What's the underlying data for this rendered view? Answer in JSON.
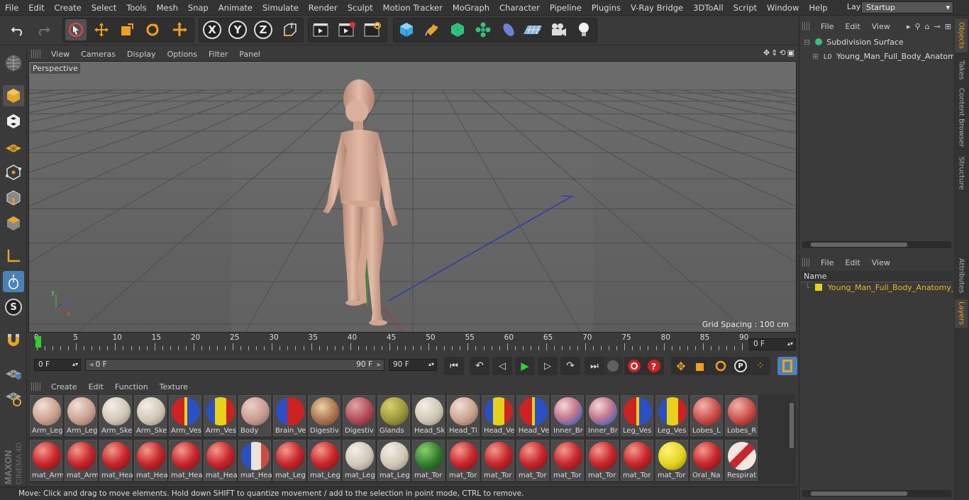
{
  "menubar": {
    "items": [
      "File",
      "Edit",
      "Create",
      "Select",
      "Tools",
      "Mesh",
      "Snap",
      "Animate",
      "Simulate",
      "Render",
      "Sculpt",
      "Motion Tracker",
      "MoGraph",
      "Character",
      "Pipeline",
      "Plugins",
      "V-Ray Bridge",
      "3DToAll",
      "Script",
      "Window",
      "Help"
    ],
    "layout_label": "Layout:",
    "layout_value": "Startup"
  },
  "toolbar": {
    "axis_x": "X",
    "axis_y": "Y",
    "axis_z": "Z"
  },
  "viewport": {
    "menu": [
      "View",
      "Cameras",
      "Display",
      "Options",
      "Filter",
      "Panel"
    ],
    "camera_label": "Perspective",
    "grid_spacing": "Grid Spacing : 100 cm",
    "axis_x": "x",
    "axis_y": "y",
    "axis_z": "z"
  },
  "timeline": {
    "ticks": [
      "0",
      "5",
      "10",
      "15",
      "20",
      "25",
      "30",
      "35",
      "40",
      "45",
      "50",
      "55",
      "60",
      "65",
      "70",
      "75",
      "80",
      "85",
      "90"
    ],
    "current_frame": "0 F"
  },
  "time_controls": {
    "start_field": "0 F",
    "range_start": "0 F",
    "range_end": "90 F",
    "end_field": "90 F"
  },
  "material_manager": {
    "menu": [
      "Create",
      "Edit",
      "Function",
      "Texture"
    ],
    "materials_row1": [
      {
        "name": "Arm_Leg",
        "kind": "skin"
      },
      {
        "name": "Arm_Leg",
        "kind": "skin"
      },
      {
        "name": "Arm_Ske",
        "kind": "bone"
      },
      {
        "name": "Arm_Ske",
        "kind": "bone"
      },
      {
        "name": "Arm_Ves",
        "kind": "vessel"
      },
      {
        "name": "Arm_Ves",
        "kind": "vessel2"
      },
      {
        "name": "Body",
        "kind": "body"
      },
      {
        "name": "Brain_Ve",
        "kind": "brainves"
      },
      {
        "name": "Digestiv",
        "kind": "digest"
      },
      {
        "name": "Digestiv",
        "kind": "digest2"
      },
      {
        "name": "Glands",
        "kind": "glands"
      },
      {
        "name": "Head_Sk",
        "kind": "bone"
      },
      {
        "name": "Head_Ti",
        "kind": "skin"
      },
      {
        "name": "Head_Ve",
        "kind": "vessel2"
      },
      {
        "name": "Head_Ve",
        "kind": "vessel"
      },
      {
        "name": "Inner_Br",
        "kind": "brain"
      },
      {
        "name": "Inner_Br",
        "kind": "brain"
      },
      {
        "name": "Leg_Ves",
        "kind": "vessel"
      },
      {
        "name": "Leg_Ves",
        "kind": "vessel2"
      },
      {
        "name": "Lobes_L",
        "kind": "lobes"
      },
      {
        "name": "Lobes_R",
        "kind": "lobes"
      }
    ],
    "materials_row2": [
      {
        "name": "mat_Arm",
        "kind": "muscle"
      },
      {
        "name": "mat_Arm",
        "kind": "muscle"
      },
      {
        "name": "mat_Hea",
        "kind": "muscle"
      },
      {
        "name": "mat_Hea",
        "kind": "muscle"
      },
      {
        "name": "mat_Hea",
        "kind": "muscle"
      },
      {
        "name": "mat_Hea",
        "kind": "muscle"
      },
      {
        "name": "mat_Hea",
        "kind": "eye"
      },
      {
        "name": "mat_Leg",
        "kind": "muscle"
      },
      {
        "name": "mat_Leg",
        "kind": "muscle"
      },
      {
        "name": "mat_Leg",
        "kind": "bone"
      },
      {
        "name": "mat_Leg",
        "kind": "bone"
      },
      {
        "name": "mat_Tor",
        "kind": "green"
      },
      {
        "name": "mat_Tor",
        "kind": "muscle"
      },
      {
        "name": "mat_Tor",
        "kind": "muscle"
      },
      {
        "name": "mat_Tor",
        "kind": "muscle"
      },
      {
        "name": "mat_Tor",
        "kind": "muscle"
      },
      {
        "name": "mat_Tor",
        "kind": "muscle"
      },
      {
        "name": "mat_Tor",
        "kind": "muscle"
      },
      {
        "name": "mat_Tor",
        "kind": "yellow"
      },
      {
        "name": "Oral_Na",
        "kind": "muscle"
      },
      {
        "name": "Respirat",
        "kind": "resp"
      }
    ]
  },
  "status_bar": {
    "text": "Move: Click and drag to move elements. Hold down SHIFT to quantize movement / add to the selection in point mode, CTRL to remove."
  },
  "object_manager": {
    "menu": [
      "File",
      "Edit",
      "View"
    ],
    "objects": [
      {
        "name": "Subdivision Surface"
      },
      {
        "name": "Young_Man_Full_Body_Anatomy_"
      }
    ]
  },
  "layer_manager": {
    "menu": [
      "File",
      "Edit",
      "View"
    ],
    "column_name": "Name",
    "layer_name": "Young_Man_Full_Body_Anatomy_M",
    "layer_color": "#e8d21a"
  },
  "side_tabs": [
    "Objects",
    "Takes",
    "Content Browser",
    "Structure",
    "Attributes",
    "Layers"
  ],
  "brand": {
    "line1": "MAXON",
    "line2": "CINEMA 4D"
  },
  "colors": {
    "accent": "#f0a020",
    "play": "#2fd02f",
    "layer_text": "#e8b923"
  }
}
